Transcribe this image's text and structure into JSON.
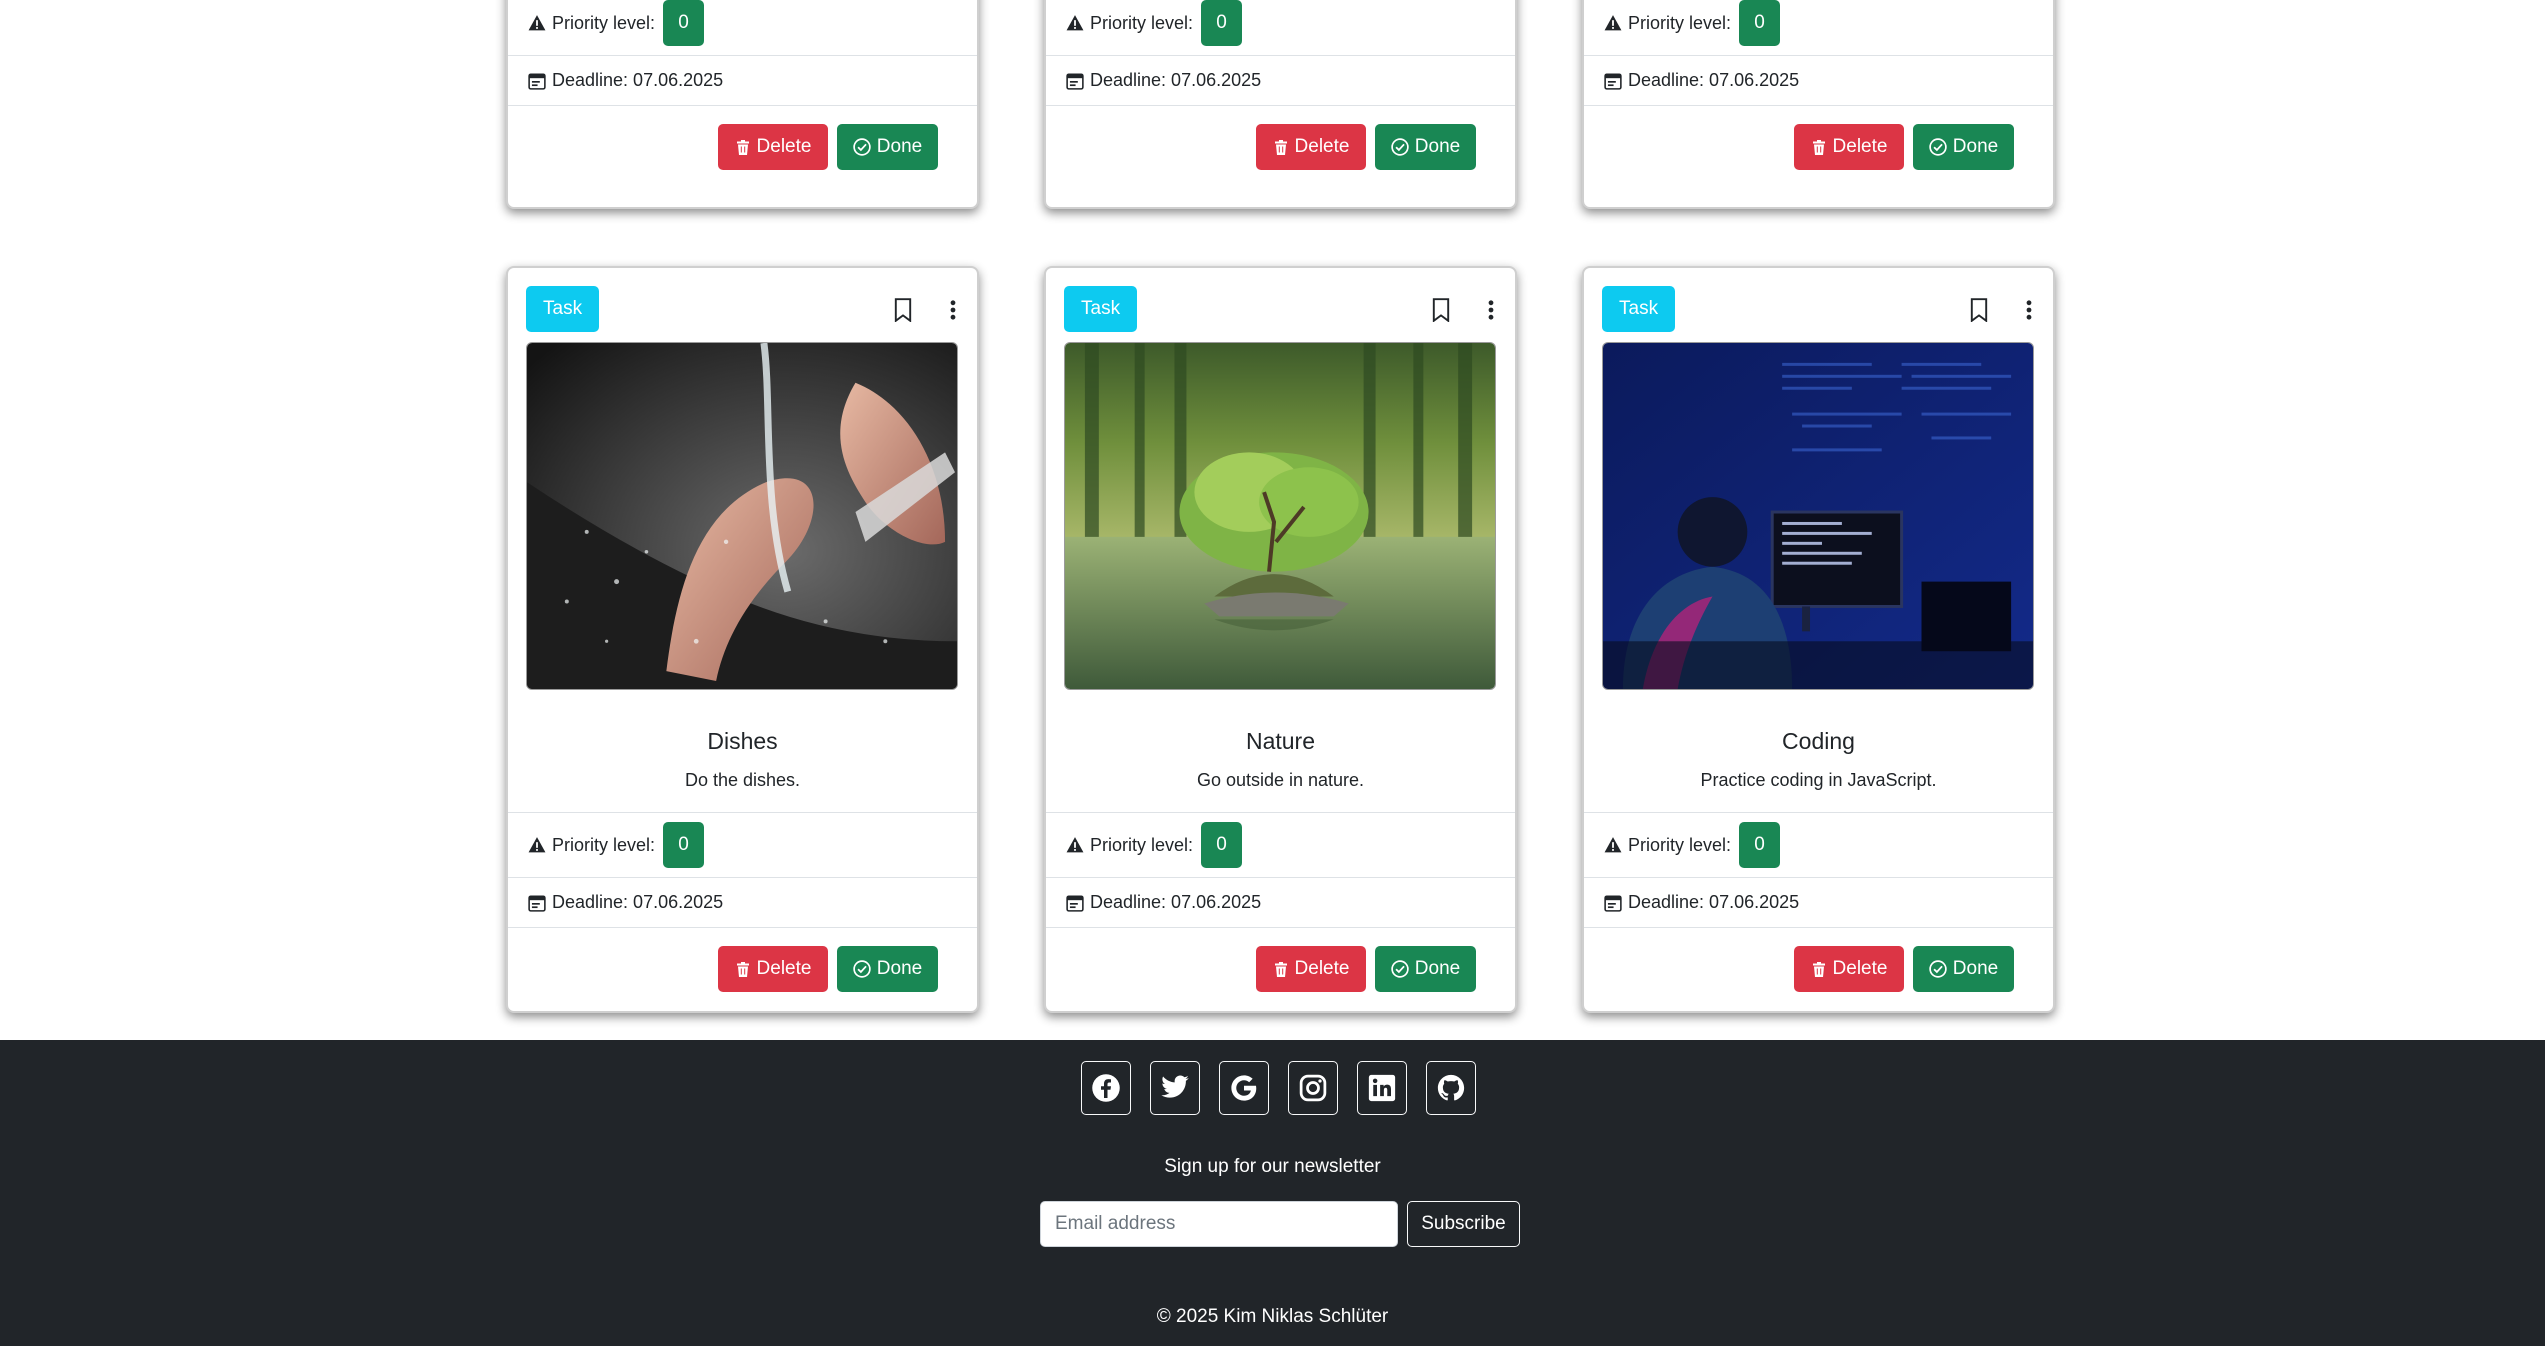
{
  "top_cards": [
    {
      "priority_label": "Priority level:",
      "priority_value": "0",
      "deadline": "Deadline: 07.06.2025",
      "delete_label": "Delete",
      "done_label": "Done"
    },
    {
      "priority_label": "Priority level:",
      "priority_value": "0",
      "deadline": "Deadline: 07.06.2025",
      "delete_label": "Delete",
      "done_label": "Done"
    },
    {
      "priority_label": "Priority level:",
      "priority_value": "0",
      "deadline": "Deadline: 07.06.2025",
      "delete_label": "Delete",
      "done_label": "Done"
    }
  ],
  "cards": [
    {
      "badge": "Task",
      "title": "Dishes",
      "text": "Do the dishes.",
      "priority_label": "Priority level:",
      "priority_value": "0",
      "deadline": "Deadline: 07.06.2025",
      "delete_label": "Delete",
      "done_label": "Done",
      "image": "hands-washing-dishes"
    },
    {
      "badge": "Task",
      "title": "Nature",
      "text": "Go outside in nature.",
      "priority_label": "Priority level:",
      "priority_value": "0",
      "deadline": "Deadline: 07.06.2025",
      "delete_label": "Delete",
      "done_label": "Done",
      "image": "tree-on-lake-island"
    },
    {
      "badge": "Task",
      "title": "Coding",
      "text": "Practice coding in JavaScript.",
      "priority_label": "Priority level:",
      "priority_value": "0",
      "deadline": "Deadline: 07.06.2025",
      "delete_label": "Delete",
      "done_label": "Done",
      "image": "person-coding-at-night"
    }
  ],
  "footer": {
    "socials": [
      "facebook-icon",
      "twitter-icon",
      "google-icon",
      "instagram-icon",
      "linkedin-icon",
      "github-icon"
    ],
    "newsletter_label": "Sign up for our newsletter",
    "email_placeholder": "Email address",
    "subscribe_label": "Subscribe",
    "copyright": "© 2025 Kim Niklas Schlüter"
  },
  "colors": {
    "task_badge": "#0dcaf0",
    "priority_badge": "#198754",
    "delete": "#dc3545",
    "done": "#198754",
    "footer_bg": "#212529"
  }
}
